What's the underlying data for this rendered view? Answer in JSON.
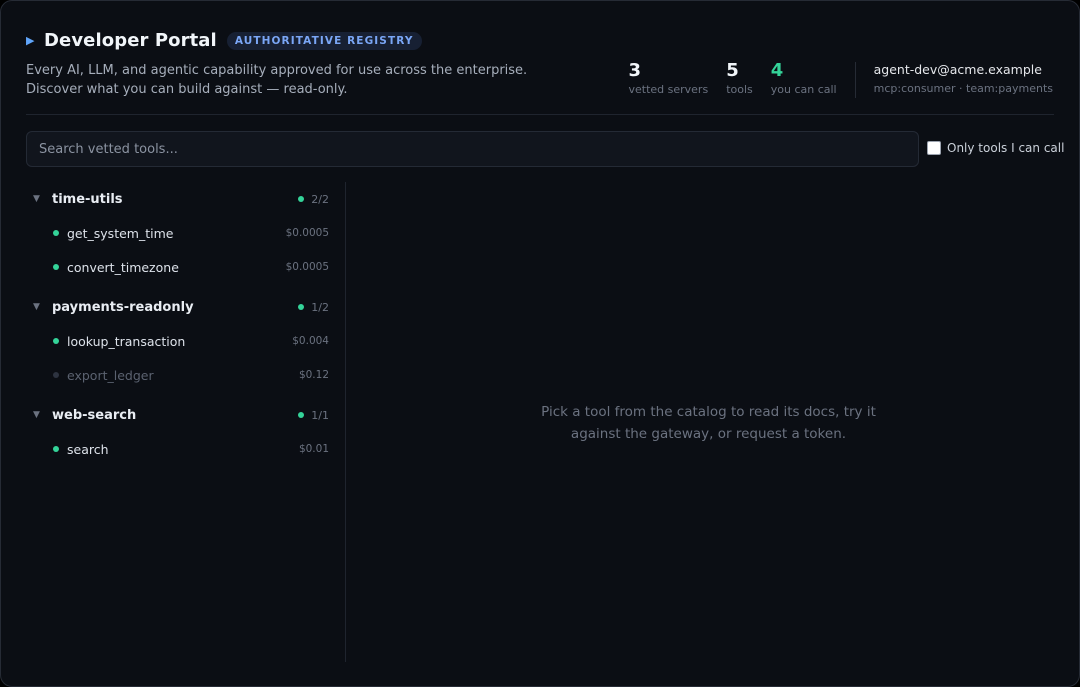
{
  "header": {
    "title": "Developer Portal",
    "badge": "AUTHORITATIVE REGISTRY",
    "subtitle_line1": "Every AI, LLM, and agentic capability approved for use across the enterprise.",
    "subtitle_line2": "Discover what you can build against — read-only."
  },
  "stats": [
    {
      "value": "3",
      "label": "vetted servers"
    },
    {
      "value": "5",
      "label": "tools"
    },
    {
      "value": "4",
      "label": "you can call"
    }
  ],
  "user": {
    "email": "agent-dev@acme.example",
    "scopes": "mcp:consumer · team:payments"
  },
  "search": {
    "placeholder": "Search vetted tools...",
    "value": ""
  },
  "filter": {
    "label": "Only tools I can call",
    "checked": false
  },
  "catalog": [
    {
      "name": "time-utils",
      "count": "2/2",
      "tools": [
        {
          "name": "get_system_time",
          "price": "$0.0005",
          "callable": true
        },
        {
          "name": "convert_timezone",
          "price": "$0.0005",
          "callable": true
        }
      ]
    },
    {
      "name": "payments-readonly",
      "count": "1/2",
      "tools": [
        {
          "name": "lookup_transaction",
          "price": "$0.004",
          "callable": true
        },
        {
          "name": "export_ledger",
          "price": "$0.12",
          "callable": false
        }
      ]
    },
    {
      "name": "web-search",
      "count": "1/1",
      "tools": [
        {
          "name": "search",
          "price": "$0.01",
          "callable": true
        }
      ]
    }
  ],
  "empty_state": {
    "line1": "Pick a tool from the catalog to read its docs, try it",
    "line2": "against the gateway, or request a token."
  },
  "colors": {
    "accent": "#60a5fa",
    "callable": "#34d399",
    "background": "#0b0e14"
  }
}
